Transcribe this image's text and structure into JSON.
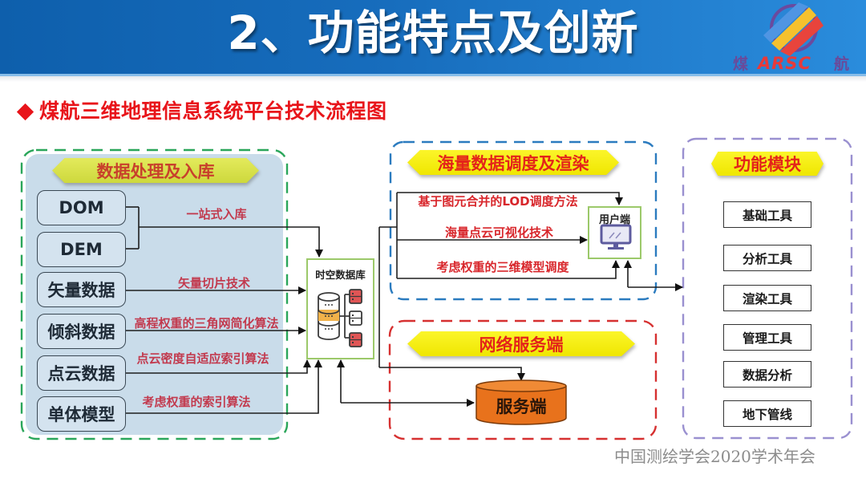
{
  "header": {
    "title": "2、功能特点及创新",
    "logo": {
      "left_char": "煤",
      "brand": "ARSC",
      "right_char": "航"
    }
  },
  "subtitle": {
    "bullet_icon": "diamond-bullet",
    "text": "煤航三维地理信息系统平台技术流程图"
  },
  "data_processing": {
    "banner": "数据处理及入库",
    "sources": [
      "DOM",
      "DEM",
      "矢量数据",
      "倾斜数据",
      "点云数据",
      "单体模型"
    ],
    "techniques": [
      "一站式入库",
      "矢量切片技术",
      "高程权重的三角网简化算法",
      "点云密度自适应索引算法",
      "考虑权重的索引算法"
    ]
  },
  "database": {
    "label": "时空数据库",
    "icon": "database-icon"
  },
  "scheduling": {
    "banner": "海量数据调度及渲染",
    "techniques": [
      "基于图元合并的LOD调度方法",
      "海量点云可视化技术",
      "考虑权重的三维模型调度"
    ],
    "client_label": "用户端",
    "client_icon": "monitor-icon"
  },
  "network_service": {
    "banner": "网络服务端",
    "server_label": "服务端"
  },
  "modules": {
    "banner": "功能模块",
    "items": [
      "基础工具",
      "分析工具",
      "渲染工具",
      "管理工具",
      "数据分析",
      "地下管线"
    ]
  },
  "footer": "中国测绘学会2020学术年会",
  "colors": {
    "header_blue": "#176dbd",
    "subtitle_red": "#e8141a",
    "panel_data_border": "#2aa65a",
    "panel_schedule_border": "#2b7bbf",
    "panel_service_border": "#d63030",
    "panel_modules_border": "#9a90d0",
    "server_orange": "#e8721c"
  }
}
